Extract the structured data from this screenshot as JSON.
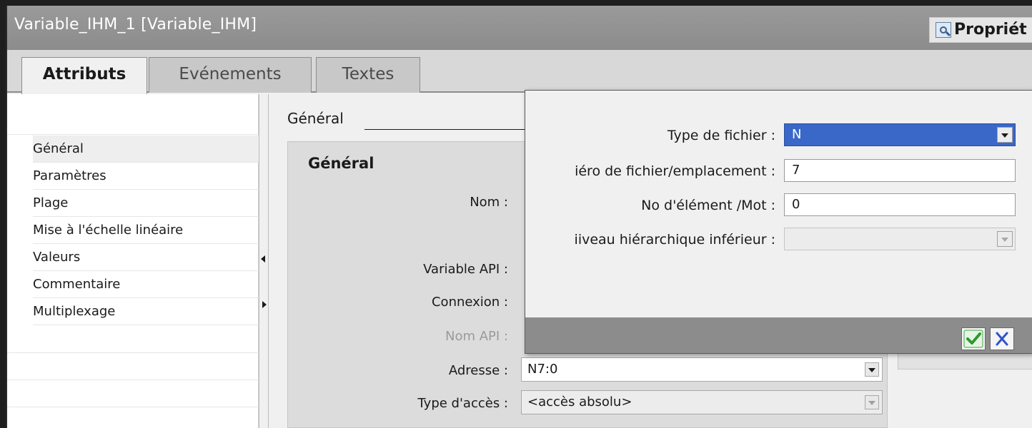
{
  "window": {
    "title": "Variable_IHM_1 [Variable_IHM]",
    "properties_tab": "Propriét"
  },
  "tabs": [
    {
      "label": "Attributs",
      "active": true
    },
    {
      "label": "Evénements",
      "active": false
    },
    {
      "label": "Textes",
      "active": false
    }
  ],
  "nav": {
    "items": [
      {
        "label": "Général",
        "selected": true
      },
      {
        "label": "Paramètres"
      },
      {
        "label": "Plage"
      },
      {
        "label": "Mise à l'échelle linéaire"
      },
      {
        "label": "Valeurs"
      },
      {
        "label": "Commentaire"
      },
      {
        "label": "Multiplexage"
      }
    ]
  },
  "content": {
    "section_header": "Général",
    "group_title": "Général",
    "fields": {
      "name_label": "Nom :",
      "api_variable_label": "Variable API :",
      "connection_label": "Connexion :",
      "api_name_label": "Nom API :",
      "address_label": "Adresse :",
      "address_value": "N7:0",
      "access_type_label": "Type d'accès :",
      "access_type_value": "<accès absolu>"
    }
  },
  "popup": {
    "file_type_label": "Type de fichier :",
    "file_type_value": "N",
    "file_number_label": "iéro de fichier/emplacement :",
    "file_number_value": "7",
    "element_label": "No d'élément /Mot :",
    "element_value": "0",
    "sublevel_label": "iiveau hiérarchique inférieur :",
    "sublevel_value": ""
  },
  "colors": {
    "titlebar": "#8c8c8c",
    "selection": "#3a68c8",
    "ok_check": "#3aa63a",
    "cancel_x": "#2f55c8"
  }
}
